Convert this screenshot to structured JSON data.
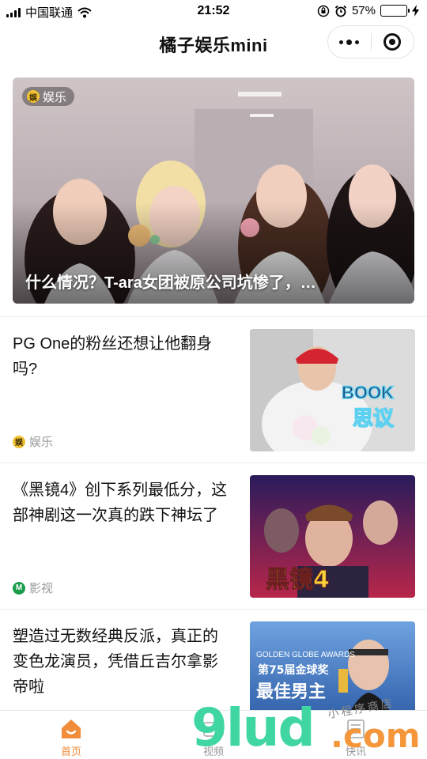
{
  "status_bar": {
    "carrier": "中国联通",
    "time": "21:52",
    "battery_percent": "57%",
    "battery_level": 0.57
  },
  "navbar": {
    "title": "橘子娱乐mini"
  },
  "hero": {
    "tag_icon": "娱",
    "tag": "娱乐",
    "caption": "什么情况？T-ara女团被原公司坑惨了，…"
  },
  "articles": [
    {
      "title": "PG One的粉丝还想让他翻身吗?",
      "category_icon": "娱",
      "category": "娱乐",
      "thumb_text": [
        "BOOK",
        "思议"
      ]
    },
    {
      "title": "《黑镜4》创下系列最低分，这部神剧这一次真的跌下神坛了",
      "category_icon": "M",
      "category": "影视",
      "thumb_text": [
        "黑镜4"
      ]
    },
    {
      "title": "塑造过无数经典反派，真正的变色龙演员，凭借丘吉尔拿影帝啦",
      "category_icon": "",
      "category": "",
      "thumb_text": [
        "GOLDEN GLOBE AWARDS",
        "第75届金球奖",
        "最佳男主"
      ]
    }
  ],
  "tabbar": {
    "tabs": [
      {
        "label": "首页",
        "active": true
      },
      {
        "label": "视频",
        "active": false
      },
      {
        "label": "快讯",
        "active": false
      }
    ]
  },
  "watermark": {
    "brand": "9lud",
    "domain": ".com",
    "small": "小程序商店"
  },
  "colors": {
    "accent": "#f08c3a",
    "entertainment_badge": "#f1c232",
    "movie_badge": "#1a9c4b"
  }
}
